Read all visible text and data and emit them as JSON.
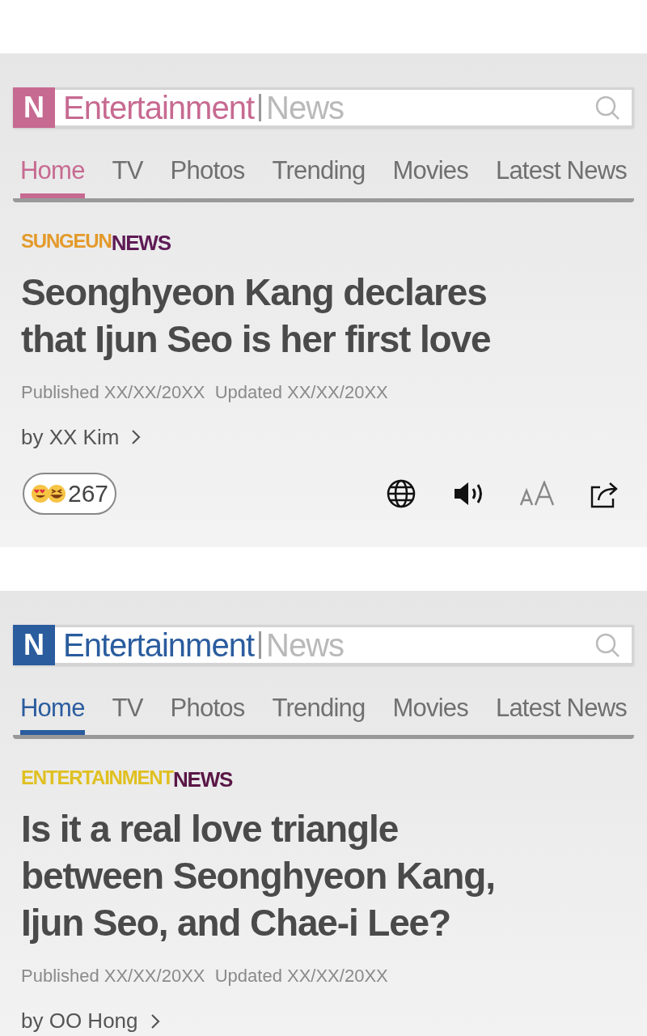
{
  "panels": [
    {
      "color": "#c76a91",
      "logo_letter": "N",
      "brand": "Entertainment",
      "section": "News",
      "tabs": [
        {
          "label": "Home",
          "selected": true
        },
        {
          "label": "TV",
          "selected": false
        },
        {
          "label": "Photos",
          "selected": false
        },
        {
          "label": "Trending",
          "selected": false
        },
        {
          "label": "Movies",
          "selected": false
        },
        {
          "label": "Latest News",
          "selected": false
        }
      ],
      "source": [
        {
          "text": "SUNGEUN",
          "color": "#e39a2a"
        },
        {
          "text": "NEWS",
          "color": "#5e1a55"
        }
      ],
      "headline": "Seonghyeon Kang declares that Ijun Seo is her first love",
      "meta": "Published XX/XX/20XX  Updated XX/XX/20XX",
      "byline": "by XX Kim",
      "reactions": {
        "count": "267"
      }
    },
    {
      "color": "#2a5c9e",
      "logo_letter": "N",
      "brand": "Entertainment",
      "section": "News",
      "tabs": [
        {
          "label": "Home",
          "selected": true
        },
        {
          "label": "TV",
          "selected": false
        },
        {
          "label": "Photos",
          "selected": false
        },
        {
          "label": "Trending",
          "selected": false
        },
        {
          "label": "Movies",
          "selected": false
        },
        {
          "label": "Latest News",
          "selected": false
        }
      ],
      "source": [
        {
          "text": "ENTERTAINMENT",
          "color": "#e0c020"
        },
        {
          "text": "NEWS",
          "color": "#5a1745"
        }
      ],
      "headline": "Is it a real love triangle between Seonghyeon Kang, Ijun Seo, and Chae-i Lee?",
      "meta": "Published XX/XX/20XX  Updated XX/XX/20XX",
      "byline": "by OO Hong"
    }
  ]
}
